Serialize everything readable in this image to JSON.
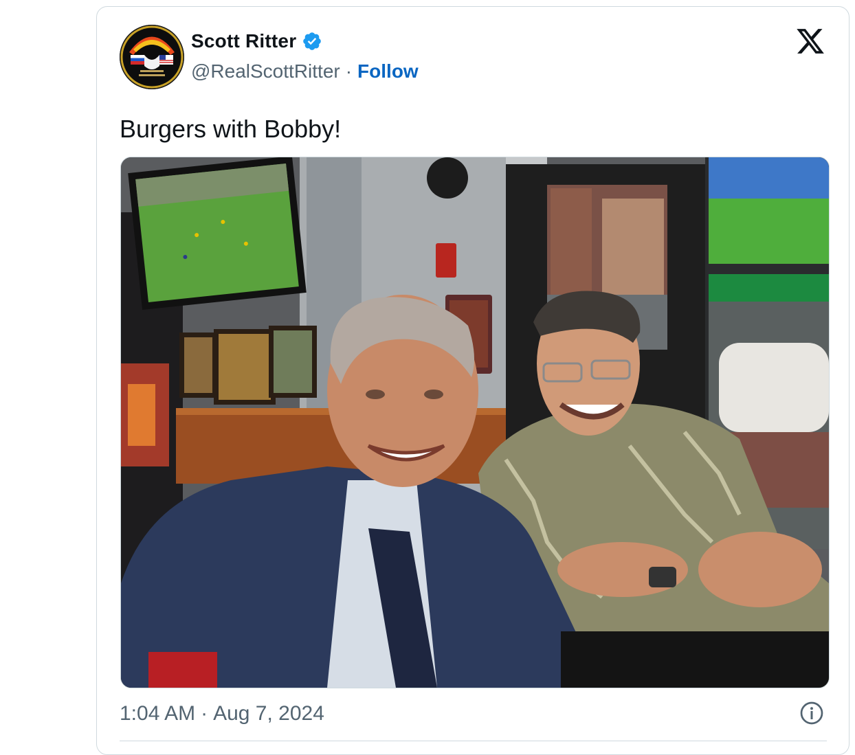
{
  "tweet": {
    "author_name": "Scott Ritter",
    "author_handle": "@RealScottRitter",
    "separator": "·",
    "follow_label": "Follow",
    "text": "Burgers with Bobby!",
    "time": "1:04 AM",
    "date": "Aug 7, 2024",
    "meta_separator": "·"
  },
  "icons": {
    "verified": "verified-badge-icon",
    "platform": "x-logo-icon",
    "info": "info-icon"
  },
  "colors": {
    "follow": "#0a66c2",
    "verified": "#1d9bf0",
    "muted": "#536471",
    "border": "#cfd9de"
  }
}
